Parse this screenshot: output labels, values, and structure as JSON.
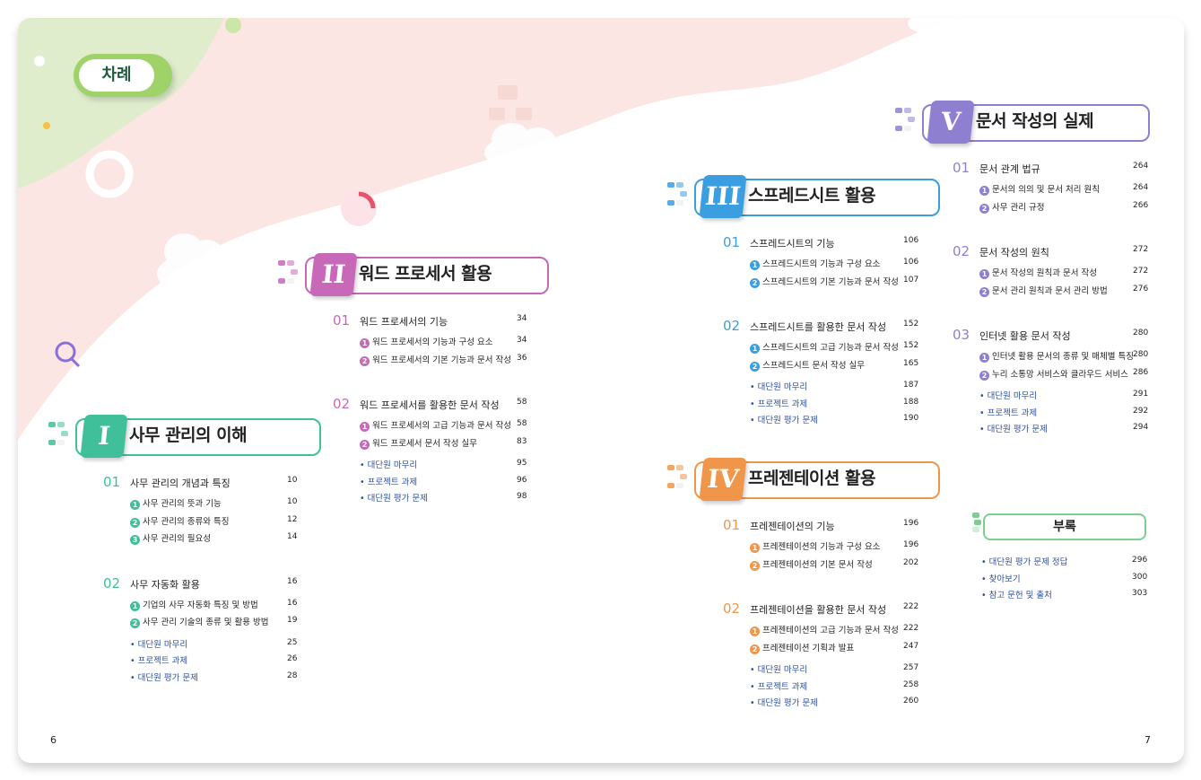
{
  "toc_label": "차례",
  "page_left": "6",
  "page_right": "7",
  "parts": [
    {
      "numeral": "I",
      "title": "사무 관리의 이해",
      "color": "#3fbf9a",
      "chapters": [
        {
          "num": "01",
          "title": "사무 관리의 개념과 특징",
          "page": "10",
          "items": [
            {
              "n": "1",
              "t": "사무 관리의 뜻과 기능",
              "p": "10"
            },
            {
              "n": "2",
              "t": "사무 관리의 종류와 특징",
              "p": "12"
            },
            {
              "n": "3",
              "t": "사무 관리의 필요성",
              "p": "14"
            }
          ]
        },
        {
          "num": "02",
          "title": "사무 자동화 활용",
          "page": "16",
          "items": [
            {
              "n": "1",
              "t": "기업의 사무 자동화 특징 및 방법",
              "p": "16"
            },
            {
              "n": "2",
              "t": "사무 관리 기술의 종류 및 활용 방법",
              "p": "19"
            }
          ]
        }
      ],
      "extras": [
        {
          "t": "• 대단원 마무리",
          "p": "25"
        },
        {
          "t": "• 프로젝트 과제",
          "p": "26"
        },
        {
          "t": "• 대단원 평가 문제",
          "p": "28"
        }
      ]
    },
    {
      "numeral": "II",
      "title": "워드 프로세서 활용",
      "color": "#c768b8",
      "chapters": [
        {
          "num": "01",
          "title": "워드 프로세서의 기능",
          "page": "34",
          "items": [
            {
              "n": "1",
              "t": "워드 프로세서의 기능과 구성 요소",
              "p": "34"
            },
            {
              "n": "2",
              "t": "워드 프로세서의 기본 기능과 문서 작성",
              "p": "36"
            }
          ]
        },
        {
          "num": "02",
          "title": "워드 프로세서를 활용한 문서 작성",
          "page": "58",
          "items": [
            {
              "n": "1",
              "t": "워드 프로세서의 고급 기능과 문서 작성",
              "p": "58"
            },
            {
              "n": "2",
              "t": "워드 프로세서 문서 작성 실무",
              "p": "83"
            }
          ]
        }
      ],
      "extras": [
        {
          "t": "• 대단원 마무리",
          "p": "95"
        },
        {
          "t": "• 프로젝트 과제",
          "p": "96"
        },
        {
          "t": "• 대단원 평가 문제",
          "p": "98"
        }
      ]
    },
    {
      "numeral": "III",
      "title": "스프레드시트 활용",
      "color": "#3a9ee0",
      "chapters": [
        {
          "num": "01",
          "title": "스프레드시트의 기능",
          "page": "106",
          "items": [
            {
              "n": "1",
              "t": "스프레드시트의 기능과 구성 요소",
              "p": "106"
            },
            {
              "n": "2",
              "t": "스프레드시트의 기본 기능과 문서 작성",
              "p": "107"
            }
          ]
        },
        {
          "num": "02",
          "title": "스프레드시트를 활용한 문서 작성",
          "page": "152",
          "items": [
            {
              "n": "1",
              "t": "스프레드시트의 고급 기능과 문서 작성",
              "p": "152"
            },
            {
              "n": "2",
              "t": "스프레드시트 문서 작성 실무",
              "p": "165"
            }
          ]
        }
      ],
      "extras": [
        {
          "t": "• 대단원 마무리",
          "p": "187"
        },
        {
          "t": "• 프로젝트 과제",
          "p": "188"
        },
        {
          "t": "• 대단원 평가 문제",
          "p": "190"
        }
      ]
    },
    {
      "numeral": "IV",
      "title": "프레젠테이션 활용",
      "color": "#f0964a",
      "chapters": [
        {
          "num": "01",
          "title": "프레젠테이션의 기능",
          "page": "196",
          "items": [
            {
              "n": "1",
              "t": "프레젠테이션의 기능과 구성 요소",
              "p": "196"
            },
            {
              "n": "2",
              "t": "프레젠테이션의 기본 문서 작성",
              "p": "202"
            }
          ]
        },
        {
          "num": "02",
          "title": "프레젠테이션을 활용한 문서 작성",
          "page": "222",
          "items": [
            {
              "n": "1",
              "t": "프레젠테이션의 고급 기능과 문서 작성",
              "p": "222"
            },
            {
              "n": "2",
              "t": "프레젠테이션 기획과 발표",
              "p": "247"
            }
          ]
        }
      ],
      "extras": [
        {
          "t": "• 대단원 마무리",
          "p": "257"
        },
        {
          "t": "• 프로젝트 과제",
          "p": "258"
        },
        {
          "t": "• 대단원 평가 문제",
          "p": "260"
        }
      ]
    },
    {
      "numeral": "V",
      "title": "문서 작성의 실제",
      "color": "#8f7fd0",
      "chapters": [
        {
          "num": "01",
          "title": "문서 관계 법규",
          "page": "264",
          "items": [
            {
              "n": "1",
              "t": "문서의 의의 및 문서 처리 원칙",
              "p": "264"
            },
            {
              "n": "2",
              "t": "사무 관리 규정",
              "p": "266"
            }
          ]
        },
        {
          "num": "02",
          "title": "문서 작성의 원칙",
          "page": "272",
          "items": [
            {
              "n": "1",
              "t": "문서 작성의 원칙과 문서 작성",
              "p": "272"
            },
            {
              "n": "2",
              "t": "문서 관리 원칙과 문서 관리 방법",
              "p": "276"
            }
          ]
        },
        {
          "num": "03",
          "title": "인터넷 활용 문서 작성",
          "page": "280",
          "items": [
            {
              "n": "1",
              "t": "인터넷 활용 문서의 종류 및 매체별 특징",
              "p": "280"
            },
            {
              "n": "2",
              "t": "누리 소통망 서비스와 클라우드 서비스",
              "p": "286"
            }
          ]
        }
      ],
      "extras": [
        {
          "t": "• 대단원 마무리",
          "p": "291"
        },
        {
          "t": "• 프로젝트 과제",
          "p": "292"
        },
        {
          "t": "• 대단원 평가 문제",
          "p": "294"
        }
      ]
    }
  ],
  "appendix": {
    "title": "부록",
    "color": "#7ccf8f",
    "items": [
      {
        "t": "• 대단원 평가 문제 정답",
        "p": "296"
      },
      {
        "t": "• 찾아보기",
        "p": "300"
      },
      {
        "t": "• 참고 문헌 및 출처",
        "p": "303"
      }
    ]
  }
}
